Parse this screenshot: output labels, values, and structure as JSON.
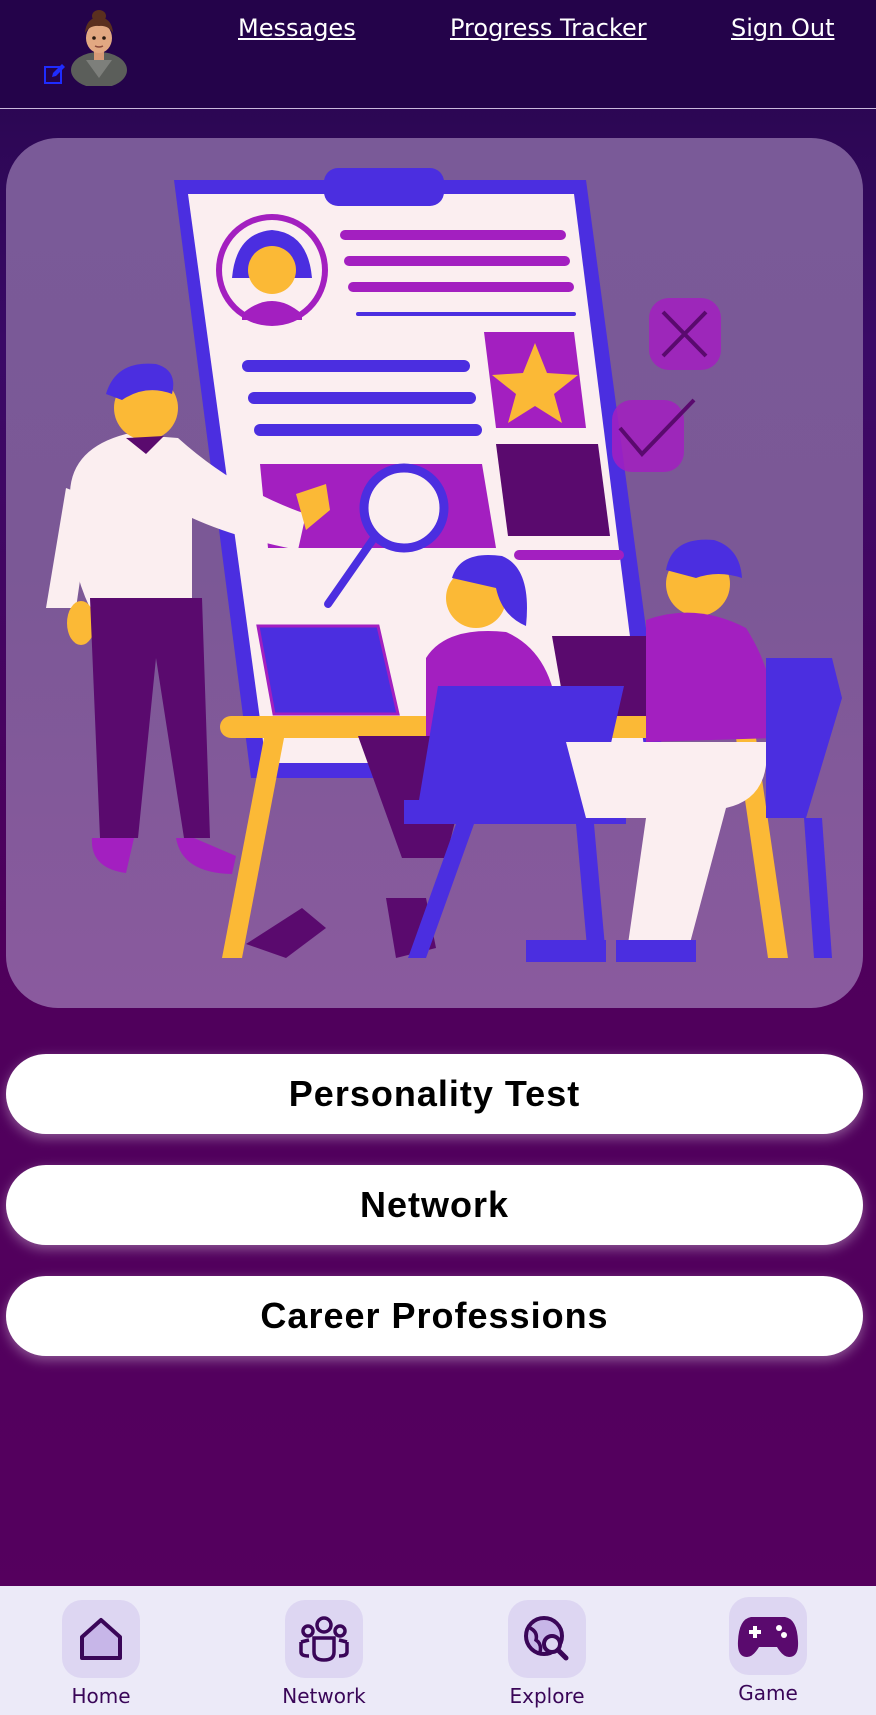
{
  "header": {
    "links": {
      "messages": "Messages",
      "progress": "Progress Tracker",
      "signout": "Sign Out"
    }
  },
  "actions": {
    "personality": "Personality Test",
    "network": "Network",
    "careers": "Career Professions"
  },
  "bottom_nav": {
    "items": [
      {
        "label": "Home",
        "icon": "home-icon"
      },
      {
        "label": "Network",
        "icon": "people-icon"
      },
      {
        "label": "Explore",
        "icon": "explore-icon"
      },
      {
        "label": "Game",
        "icon": "gamepad-icon"
      }
    ]
  },
  "colors": {
    "header_bg": "#24034a",
    "page_bg": "#56005f",
    "nav_bg": "#eceaf8",
    "accent_purple": "#4b2ee0",
    "accent_magenta": "#a31fc0",
    "accent_yellow": "#fbb936"
  }
}
